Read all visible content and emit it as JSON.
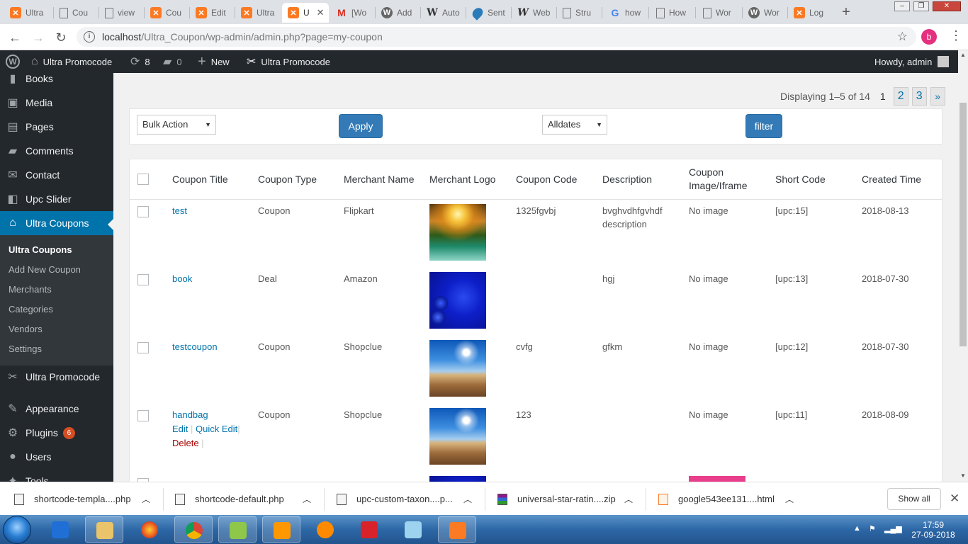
{
  "browser": {
    "tabs": [
      {
        "title": "Ultra",
        "icon": "xampp-icon",
        "active": false
      },
      {
        "title": "Cou",
        "icon": "doc-icon",
        "active": false
      },
      {
        "title": "view",
        "icon": "doc-icon",
        "active": false
      },
      {
        "title": "Cou",
        "icon": "xampp-icon",
        "active": false
      },
      {
        "title": "Edit",
        "icon": "xampp-icon",
        "active": false
      },
      {
        "title": "Ultra",
        "icon": "xampp-icon",
        "active": false
      },
      {
        "title": "U",
        "icon": "xampp-icon",
        "active": true
      },
      {
        "title": "[Wo",
        "icon": "gmail-icon",
        "active": false
      },
      {
        "title": "Add",
        "icon": "wordpress-icon",
        "active": false
      },
      {
        "title": "Auto",
        "icon": "wordpress-w-icon",
        "active": false
      },
      {
        "title": "Sent",
        "icon": "sentry-icon",
        "active": false
      },
      {
        "title": "Web",
        "icon": "webflow-w-icon",
        "active": false
      },
      {
        "title": "Stru",
        "icon": "doc-icon",
        "active": false
      },
      {
        "title": "how",
        "icon": "google-icon",
        "active": false
      },
      {
        "title": "How",
        "icon": "doc-icon",
        "active": false
      },
      {
        "title": "Wor",
        "icon": "doc-icon",
        "active": false
      },
      {
        "title": "Wor",
        "icon": "wordpress-icon",
        "active": false
      },
      {
        "title": "Log",
        "icon": "xampp-icon",
        "active": false
      }
    ],
    "url_host": "localhost",
    "url_path": "/Ultra_Coupon/wp-admin/admin.php?page=my-coupon",
    "profile_letter": "b"
  },
  "adminbar": {
    "site_name": "Ultra Promocode",
    "updates_count": "8",
    "comments_count": "0",
    "new_label": "New",
    "plugin_label": "Ultra Promocode",
    "howdy": "Howdy, admin"
  },
  "sidebar": {
    "items": [
      {
        "label": "Books",
        "icon": "books-icon"
      },
      {
        "label": "Media",
        "icon": "media-icon"
      },
      {
        "label": "Pages",
        "icon": "pages-icon"
      },
      {
        "label": "Comments",
        "icon": "comments-icon"
      },
      {
        "label": "Contact",
        "icon": "mail-icon"
      },
      {
        "label": "Upc Slider",
        "icon": "slider-icon"
      },
      {
        "label": "Ultra Coupons",
        "icon": "store-icon"
      },
      {
        "label": "Ultra Promocode",
        "icon": "scissors-icon"
      },
      {
        "label": "Appearance",
        "icon": "brush-icon"
      },
      {
        "label": "Plugins",
        "icon": "plugin-icon",
        "badge": "6"
      },
      {
        "label": "Users",
        "icon": "users-icon"
      },
      {
        "label": "Tools",
        "icon": "tools-icon"
      }
    ],
    "submenu": [
      "Ultra Coupons",
      "Add New Coupon",
      "Merchants",
      "Categories",
      "Vendors",
      "Settings"
    ]
  },
  "pagination": {
    "summary": "Displaying 1–5 of 14",
    "current": "1",
    "pages": [
      "2",
      "3"
    ],
    "next": "»"
  },
  "filters": {
    "bulk_action": "Bulk Action",
    "apply": "Apply",
    "dates": "Alldates",
    "filter": "filter"
  },
  "table": {
    "headers": [
      "Coupon Title",
      "Coupon Type",
      "Merchant Name",
      "Merchant Logo",
      "Coupon Code",
      "Description",
      "Coupon Image/Iframe",
      "Short Code",
      "Created Time"
    ],
    "rows": [
      {
        "title": "test",
        "type": "Coupon",
        "merchant": "Flipkart",
        "logo": "waterfall-image",
        "code": "1325fgvbj",
        "description": "bvghvdhfgvhdf description",
        "image": "No image",
        "shortcode": "[upc:15]",
        "created": "2018-08-13"
      },
      {
        "title": "book",
        "type": "Deal",
        "merchant": "Amazon",
        "logo": "blue-baubles-image",
        "code": "",
        "description": "hgj",
        "image": "No image",
        "shortcode": "[upc:13]",
        "created": "2018-07-30"
      },
      {
        "title": "testcoupon",
        "type": "Coupon",
        "merchant": "Shopclue",
        "logo": "desert-sun-image",
        "code": "cvfg",
        "description": "gfkm",
        "image": "No image",
        "shortcode": "[upc:12]",
        "created": "2018-07-30"
      },
      {
        "title": "handbag",
        "type": "Coupon",
        "merchant": "Shopclue",
        "logo": "desert-sun-image",
        "code": "123",
        "description": "",
        "image": "No image",
        "shortcode": "[upc:11]",
        "created": "2018-08-09",
        "actions": {
          "edit": "Edit",
          "quick_edit": "Quick Edit",
          "delete": "Delete"
        }
      }
    ]
  },
  "downloads": [
    {
      "name": "shortcode-templa....php",
      "icon": "php-file-icon"
    },
    {
      "name": "shortcode-default.php",
      "icon": "php-file-icon"
    },
    {
      "name": "upc-custom-taxon....p...",
      "icon": "php-file-icon"
    },
    {
      "name": "universal-star-ratin....zip",
      "icon": "zip-file-icon"
    },
    {
      "name": "google543ee131....html",
      "icon": "html-file-icon"
    }
  ],
  "show_all": "Show all",
  "taskbar": {
    "time": "17:59",
    "date": "27-09-2018"
  },
  "colors": {
    "wp_blue": "#0073aa",
    "admin_dark": "#23282d",
    "button_blue": "#337ab7",
    "delete_red": "#a00"
  }
}
